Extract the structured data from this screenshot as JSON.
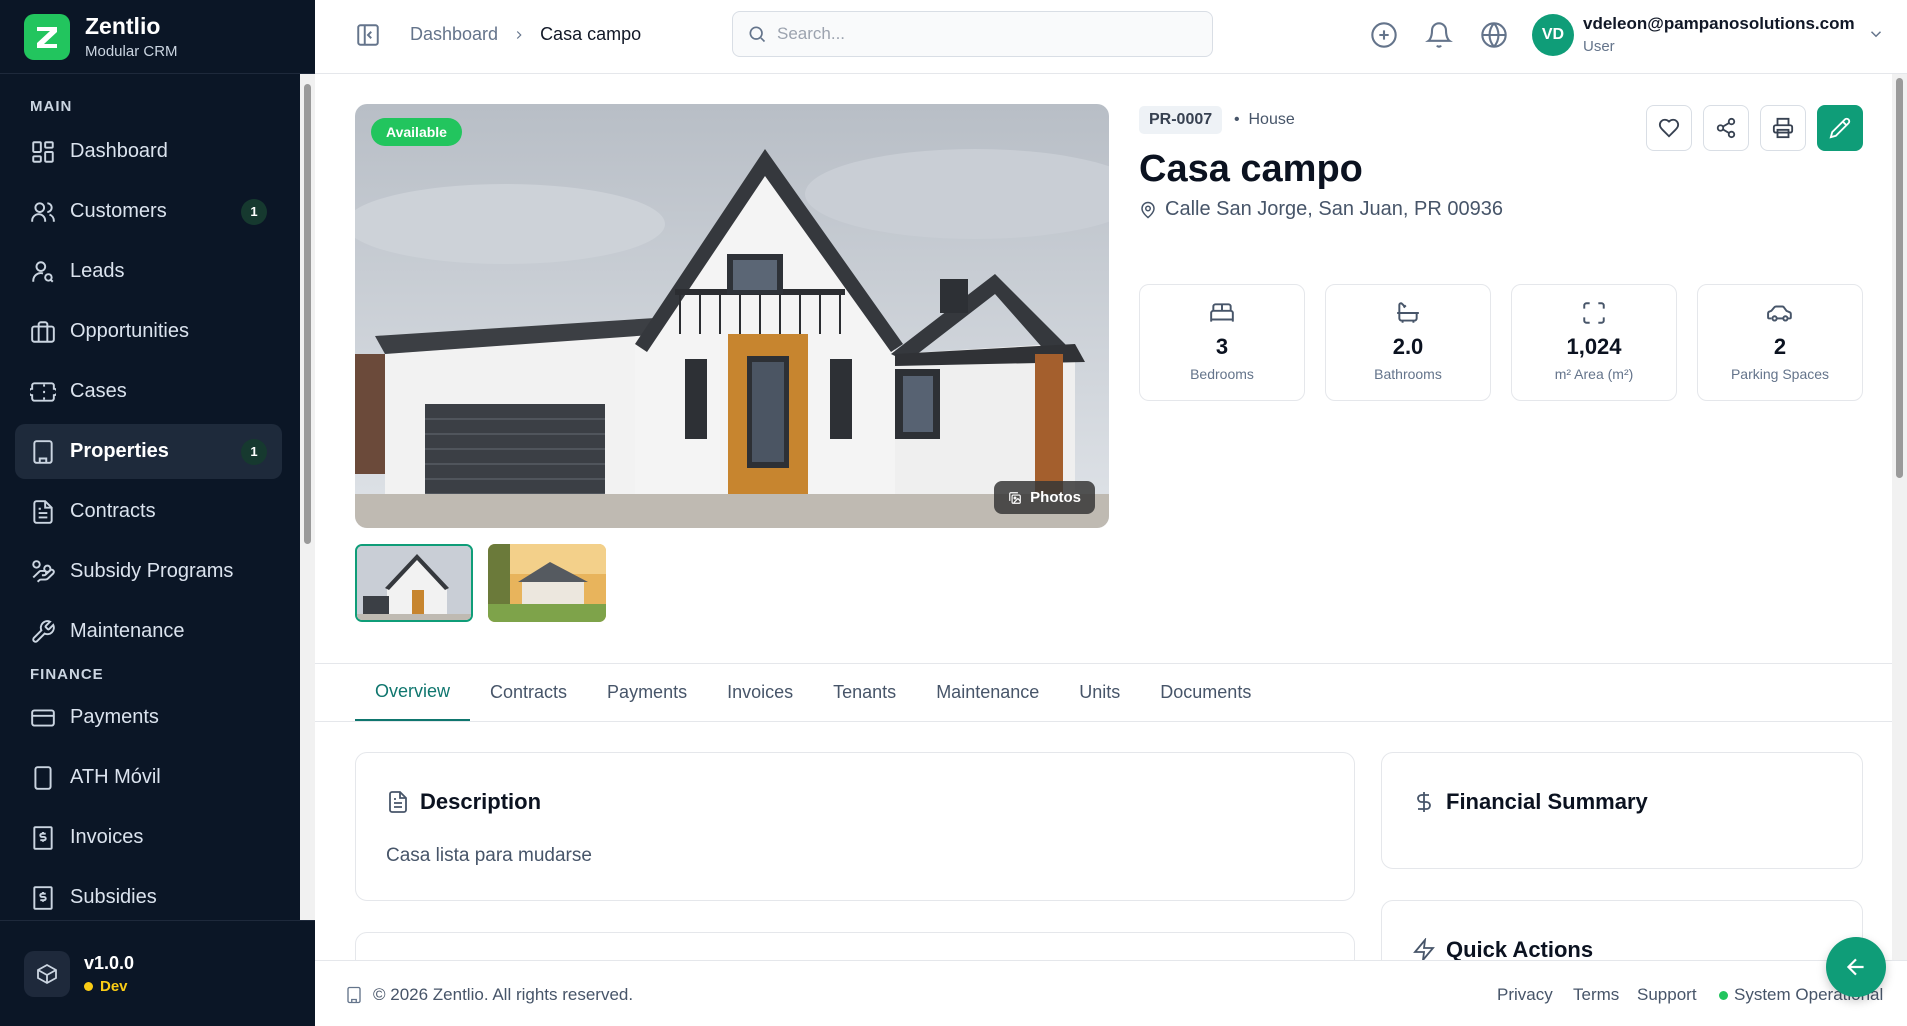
{
  "brand": {
    "name": "Zentlio",
    "subtitle": "Modular CRM"
  },
  "sidebar": {
    "sections": {
      "main": "MAIN",
      "finance": "FINANCE"
    },
    "items": [
      {
        "label": "Dashboard",
        "icon": "dashboard-icon"
      },
      {
        "label": "Customers",
        "icon": "users-icon",
        "badge": "1"
      },
      {
        "label": "Leads",
        "icon": "user-search-icon"
      },
      {
        "label": "Opportunities",
        "icon": "briefcase-icon"
      },
      {
        "label": "Cases",
        "icon": "ticket-icon"
      },
      {
        "label": "Properties",
        "icon": "building-icon",
        "badge": "1",
        "active": true
      },
      {
        "label": "Contracts",
        "icon": "file-text-icon"
      },
      {
        "label": "Subsidy Programs",
        "icon": "hand-coins-icon"
      },
      {
        "label": "Maintenance",
        "icon": "wrench-icon"
      },
      {
        "label": "Payments",
        "icon": "credit-card-icon"
      },
      {
        "label": "ATH Móvil",
        "icon": "smartphone-icon"
      },
      {
        "label": "Invoices",
        "icon": "receipt-icon"
      },
      {
        "label": "Subsidies",
        "icon": "receipt-icon"
      }
    ],
    "version": {
      "number": "v1.0.0",
      "env": "Dev"
    }
  },
  "header": {
    "breadcrumb": {
      "home": "Dashboard",
      "current": "Casa campo"
    },
    "search_placeholder": "Search...",
    "user": {
      "initials": "VD",
      "email": "vdeleon@pampanosolutions.com",
      "role": "User"
    }
  },
  "property": {
    "status": "Available",
    "photos_label": "Photos",
    "code": "PR-0007",
    "type": "House",
    "title": "Casa campo",
    "address": "Calle San Jorge, San Juan, PR 00936",
    "stats": [
      {
        "value": "3",
        "label": "Bedrooms",
        "icon": "bed-icon"
      },
      {
        "value": "2.0",
        "label": "Bathrooms",
        "icon": "bath-icon"
      },
      {
        "value": "1,024",
        "label": "m² Area (m²)",
        "icon": "expand-icon"
      },
      {
        "value": "2",
        "label": "Parking Spaces",
        "icon": "car-icon"
      }
    ]
  },
  "tabs": [
    "Overview",
    "Contracts",
    "Payments",
    "Invoices",
    "Tenants",
    "Maintenance",
    "Units",
    "Documents"
  ],
  "cards": {
    "description": {
      "title": "Description",
      "body": "Casa lista para mudarse"
    },
    "financial": {
      "title": "Financial Summary"
    },
    "quick": {
      "title": "Quick Actions"
    }
  },
  "footer": {
    "copyright": "© 2026 Zentlio. All rights reserved.",
    "links": [
      "Privacy",
      "Terms",
      "Support"
    ],
    "status": "System Operational"
  },
  "colors": {
    "accent": "#0f9d78",
    "sidebar_bg": "#0b1626",
    "status_green": "#22c55e",
    "env_yellow": "#facc15"
  }
}
